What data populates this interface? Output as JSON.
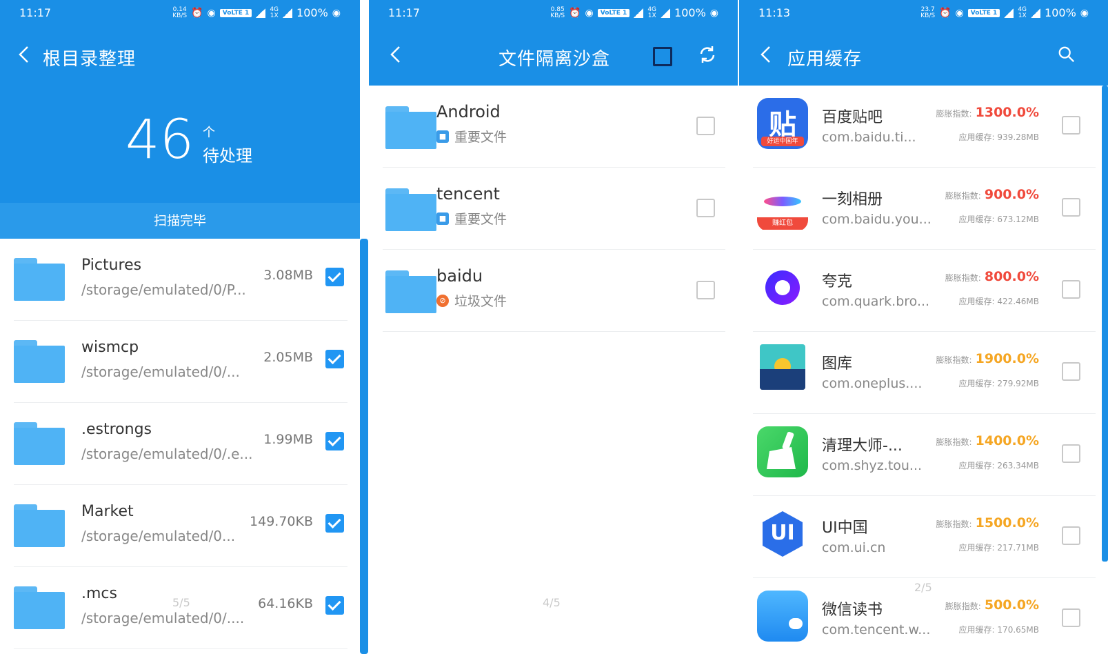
{
  "colors": {
    "primary": "#1a8fe6",
    "check": "#2196f3",
    "folder": "#4fb3f5",
    "red_value": "#f04a3c",
    "orange_value": "#f5a623"
  },
  "status_bars": [
    {
      "time": "11:17",
      "speed_top": "0.14",
      "speed_bottom": "KB/S",
      "battery": "100%"
    },
    {
      "time": "11:17",
      "speed_top": "0.85",
      "speed_bottom": "KB/S",
      "battery": "100%"
    },
    {
      "time": "11:13",
      "speed_top": "23.7",
      "speed_bottom": "KB/S",
      "battery": "100%"
    }
  ],
  "status_common": {
    "volte": "VoLTE 1",
    "network": "4G",
    "sub": "1X"
  },
  "panel1": {
    "title": "根目录整理",
    "count": "46",
    "count_unit": "个",
    "count_label": "待处理",
    "scan_status": "扫描完毕",
    "pager": "5/5",
    "items": [
      {
        "name": "Pictures",
        "path": "/storage/emulated/0/P...",
        "size": "3.08MB",
        "checked": true
      },
      {
        "name": "wismcp",
        "path": "/storage/emulated/0/...",
        "size": "2.05MB",
        "checked": true
      },
      {
        "name": ".estrongs",
        "path": "/storage/emulated/0/.e...",
        "size": "1.99MB",
        "checked": true
      },
      {
        "name": "Market",
        "path": "/storage/emulated/0...",
        "size": "149.70KB",
        "checked": true
      },
      {
        "name": ".mcs",
        "path": "/storage/emulated/0/....",
        "size": "64.16KB",
        "checked": true
      }
    ]
  },
  "panel2": {
    "title": "文件隔离沙盒",
    "pager": "4/5",
    "items": [
      {
        "name": "Android",
        "tag": "重要文件",
        "tag_type": "important",
        "checked": false
      },
      {
        "name": "tencent",
        "tag": "重要文件",
        "tag_type": "important",
        "checked": false
      },
      {
        "name": "baidu",
        "tag": "垃圾文件",
        "tag_type": "trash",
        "checked": false
      }
    ]
  },
  "panel3": {
    "title": "应用缓存",
    "pager": "2/5",
    "bloat_label": "膨胀指数:",
    "cache_label": "应用缓存:",
    "apps": [
      {
        "name": "百度贴吧",
        "package": "com.baidu.ti...",
        "bloat": "1300.0%",
        "cache": "939.28MB",
        "level": "red",
        "icon": "tieba-icon",
        "glyph": "贴",
        "badge": "好运中国年"
      },
      {
        "name": "一刻相册",
        "package": "com.baidu.you...",
        "bloat": "900.0%",
        "cache": "673.12MB",
        "level": "red",
        "icon": "yike-album-icon",
        "glyph": "",
        "badge": "赚红包"
      },
      {
        "name": "夸克",
        "package": "com.quark.bro...",
        "bloat": "800.0%",
        "cache": "422.46MB",
        "level": "red",
        "icon": "quark-icon",
        "glyph": "",
        "badge": ""
      },
      {
        "name": "图库",
        "package": "com.oneplus....",
        "bloat": "1900.0%",
        "cache": "279.92MB",
        "level": "orange",
        "icon": "gallery-icon",
        "glyph": "",
        "badge": ""
      },
      {
        "name": "清理大师-...",
        "package": "com.shyz.tou...",
        "bloat": "1400.0%",
        "cache": "263.34MB",
        "level": "orange",
        "icon": "cleaner-broom-icon",
        "glyph": "",
        "badge": ""
      },
      {
        "name": "UI中国",
        "package": "com.ui.cn",
        "bloat": "1500.0%",
        "cache": "217.71MB",
        "level": "orange",
        "icon": "ui-china-icon",
        "glyph": "UI",
        "badge": ""
      },
      {
        "name": "微信读书",
        "package": "com.tencent.w...",
        "bloat": "500.0%",
        "cache": "170.65MB",
        "level": "orange",
        "icon": "weread-icon",
        "glyph": "",
        "badge": ""
      }
    ]
  }
}
